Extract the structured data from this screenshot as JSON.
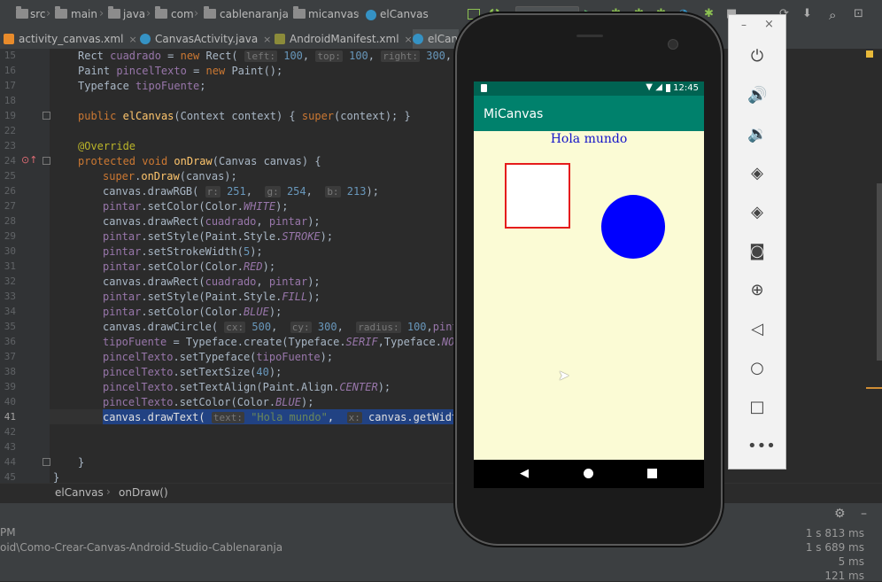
{
  "navbar": {
    "crumbs": [
      "src",
      "main",
      "java",
      "com",
      "cablenaranja",
      "micanvas",
      "elCanvas"
    ]
  },
  "tabs": [
    {
      "label": "activity_canvas.xml"
    },
    {
      "label": "CanvasActivity.java"
    },
    {
      "label": "AndroidManifest.xml"
    },
    {
      "label": "elCan"
    }
  ],
  "editor": {
    "line_numbers": [
      "15",
      "16",
      "17",
      "18",
      "19",
      "22",
      "23",
      "24",
      "25",
      "26",
      "27",
      "28",
      "29",
      "30",
      "31",
      "32",
      "33",
      "34",
      "35",
      "36",
      "37",
      "38",
      "39",
      "40",
      "41",
      "42",
      "43",
      "44",
      "45"
    ]
  },
  "breadcrumb": {
    "class_name": "elCanvas",
    "method_name": "onDraw()"
  },
  "bottom_panel": {
    "left_partial_1": "PM",
    "path": "oid\\Como-Crear-Canvas-Android-Studio-Cablenaranja",
    "times": [
      "1 s 813 ms",
      "1 s 689 ms",
      "5 ms",
      "121 ms"
    ]
  },
  "emulator": {
    "clock": "12:45",
    "app_title": "MiCanvas",
    "canvas_text": "Hola mundo",
    "canvas_background": "#fbfbd5",
    "square_stroke": "#e51c1c",
    "circle_fill": "#0000ff",
    "toolbar_icons": [
      "power-icon",
      "volume-up-icon",
      "volume-down-icon",
      "rotate-left-icon",
      "rotate-right-icon",
      "camera-icon",
      "zoom-icon",
      "back-icon",
      "home-icon",
      "overview-icon",
      "more-icon"
    ]
  },
  "colors": {
    "ide_bg": "#2b2b2b",
    "keyword": "#cc7832",
    "method": "#ffc66d",
    "number": "#6897bb",
    "selection": "#214283"
  }
}
